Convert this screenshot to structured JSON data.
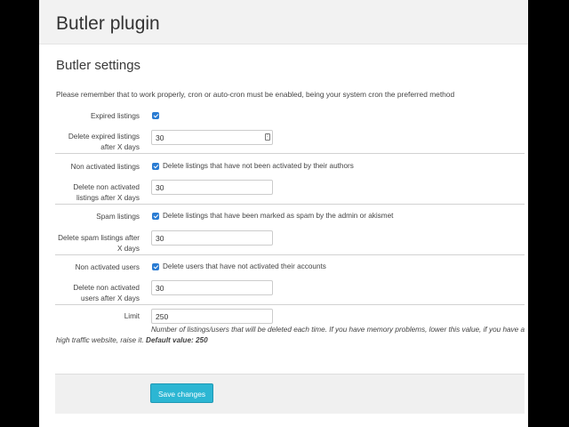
{
  "header": {
    "title": "Butler plugin"
  },
  "section": {
    "title": "Butler settings",
    "notice": "Please remember that to work properly, cron or auto-cron must be enabled, being your system cron the preferred method"
  },
  "settings": {
    "expired": {
      "label": "Expired listings",
      "checked": true,
      "days_label_1": "Delete expired listings",
      "days_label_2": "after X days",
      "days_value": "30"
    },
    "non_activated_listings": {
      "label": "Non activated listings",
      "checked": true,
      "checkbox_text": "Delete listings that have not been activated by their authors",
      "days_label_1": "Delete non activated",
      "days_label_2": "listings after X days",
      "days_value": "30"
    },
    "spam": {
      "label": "Spam listings",
      "checked": true,
      "checkbox_text": "Delete listings that have been marked as spam by the admin or akismet",
      "days_label_1": "Delete spam listings after",
      "days_label_2": "X days",
      "days_value": "30"
    },
    "non_activated_users": {
      "label": "Non activated users",
      "checked": true,
      "checkbox_text": "Delete users that have not activated their accounts",
      "days_label_1": "Delete non activated",
      "days_label_2": "users after X days",
      "days_value": "30"
    },
    "limit": {
      "label": "Limit",
      "value": "250",
      "help_line_1": "Number of listings/users that will be deleted each time. If you have memory problems, lower this value, if you have a",
      "help_line_2": "high traffic website, raise it.",
      "help_default": "Default value: 250"
    }
  },
  "footer": {
    "save_label": "Save changes"
  },
  "colors": {
    "accent": "#2cb6d3",
    "checkbox": "#2a7cd3"
  }
}
